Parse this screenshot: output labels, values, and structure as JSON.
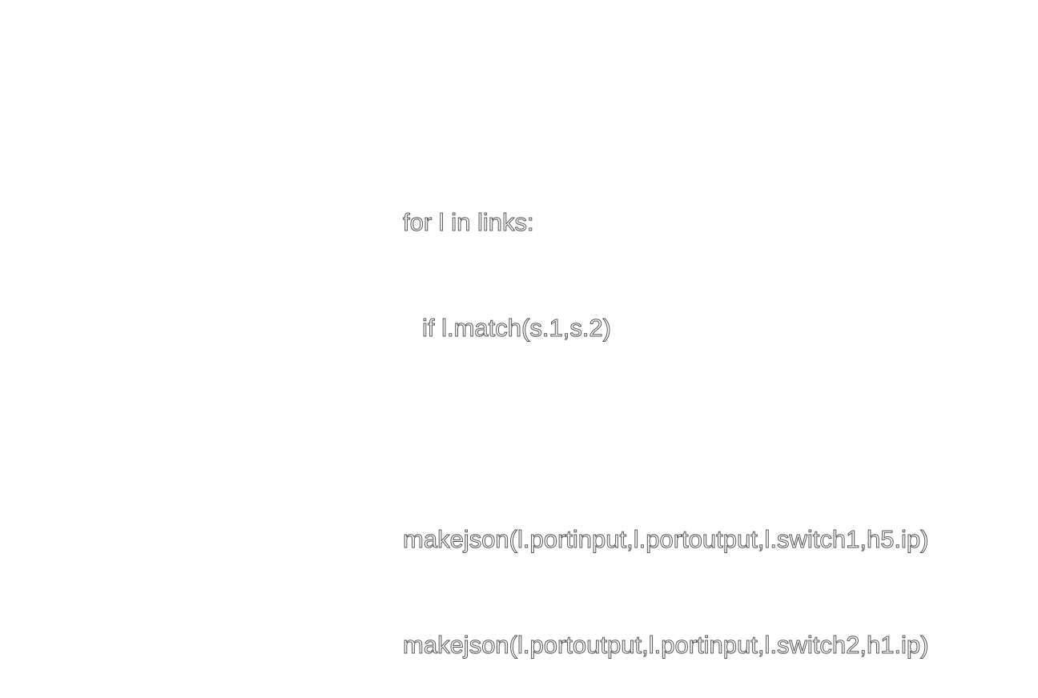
{
  "code": {
    "lines": [
      "for l in links:",
      "if l.match(s.1,s.2)",
      "",
      "makejson(l.portinput,l.portoutput,l.switch1,h5.ip)",
      "makejson(l.portoutput,l.portinput,l.switch2,h1.ip)"
    ]
  }
}
